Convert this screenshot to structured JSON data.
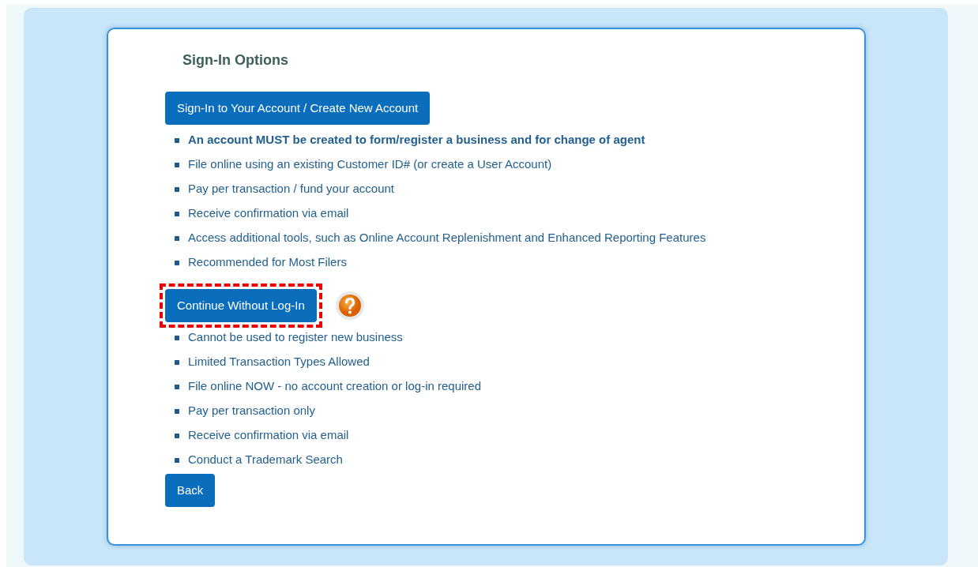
{
  "title": "Sign-In Options",
  "sections": [
    {
      "button": {
        "label": "Sign-In to Your Account / Create New Account",
        "highlighted": false
      },
      "help": false,
      "items": [
        {
          "text": "An account MUST be created to form/register a business and for change of agent",
          "bold": true
        },
        {
          "text": "File online using an existing Customer ID# (or create a User Account)",
          "bold": false
        },
        {
          "text": "Pay per transaction / fund your account",
          "bold": false
        },
        {
          "text": "Receive confirmation via email",
          "bold": false
        },
        {
          "text": "Access additional tools, such as Online Account Replenishment and Enhanced Reporting Features",
          "bold": false
        },
        {
          "text": "Recommended for Most Filers",
          "bold": false
        }
      ]
    },
    {
      "button": {
        "label": "Continue Without Log-In",
        "highlighted": true
      },
      "help": true,
      "items": [
        {
          "text": "Cannot be used to register new business",
          "bold": false
        },
        {
          "text": "Limited Transaction Types Allowed",
          "bold": false
        },
        {
          "text": "File online NOW - no account creation or log-in required",
          "bold": false
        },
        {
          "text": "Pay per transaction only",
          "bold": false
        },
        {
          "text": "Receive confirmation via email",
          "bold": false
        },
        {
          "text": "Conduct a Trademark Search",
          "bold": false
        }
      ]
    }
  ],
  "back_button": "Back"
}
